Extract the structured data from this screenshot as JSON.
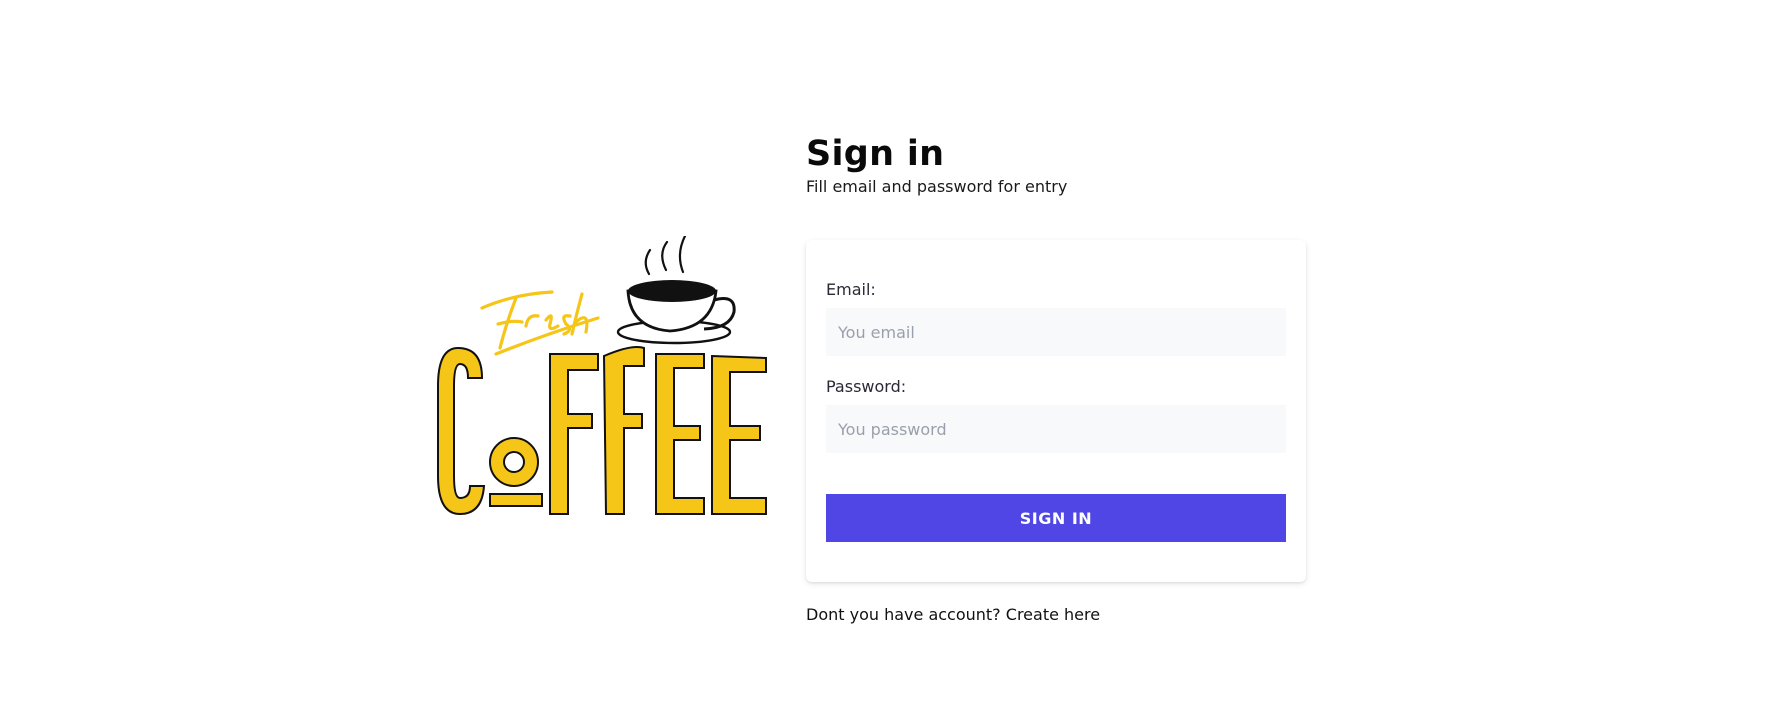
{
  "logo": {
    "script_word": "Fresh",
    "block_word": "COFFEE",
    "brand_color": "#f5c518",
    "icon": "coffee-cup-icon"
  },
  "header": {
    "title": "Sign in",
    "subtitle": "Fill email and password for entry"
  },
  "form": {
    "email_label": "Email:",
    "email_placeholder": "You email",
    "email_value": "",
    "password_label": "Password:",
    "password_placeholder": "You password",
    "password_value": "",
    "submit_label": "SIGN IN"
  },
  "footer": {
    "prompt": "Dont you have account?",
    "link": "Create here"
  },
  "colors": {
    "accent": "#4f46e5",
    "input_bg": "#f8f9fb"
  }
}
